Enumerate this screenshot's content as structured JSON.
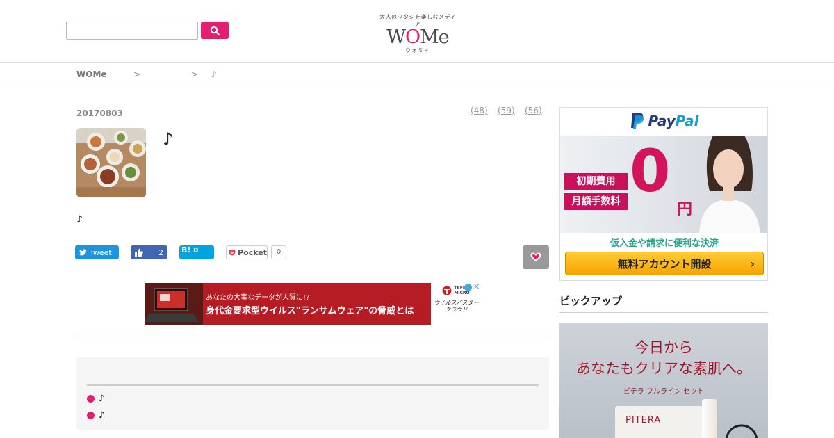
{
  "header": {
    "search_placeholder": "",
    "logo_tagline": "大人のワタシを楽しむメディア",
    "logo_wo": "W",
    "logo_o": "O",
    "logo_me": "Me",
    "logo_reading": "ウォミィ"
  },
  "breadcrumb": {
    "home": "WOMe",
    "sep1": ">",
    "sep2": ">",
    "current": "♪"
  },
  "article": {
    "date": "20170803",
    "counts": [
      "(48)",
      "(59)",
      "(56)"
    ],
    "title": "♪",
    "body": "♪"
  },
  "share": {
    "tweet": "Tweet",
    "like_count": "2",
    "hatena_label": "B!",
    "hatena_count": "0",
    "pocket_label": "Pocket",
    "pocket_count": "0"
  },
  "banner_ad": {
    "line1": "あなたの大事なデータが人質に!?",
    "line2": "身代金要求型ウイルス\"ランサムウェア\"の脅威とは",
    "brand": "TREND MICRO",
    "product": "ウイルスバスター クラウド"
  },
  "toc": {
    "items": [
      "♪",
      "♪"
    ]
  },
  "sidebar": {
    "paypal": {
      "logo_pay": "Pay",
      "logo_pal": "Pal",
      "tag1": "初期費用",
      "tag2": "月額手数料",
      "zero": "0",
      "yen": "円",
      "note": "仮入金や請求に便利な決済",
      "cta": "無料アカウント開設",
      "cta_chevron": "›"
    },
    "pickup_title": "ピックアップ",
    "pitera": {
      "headline1": "今日から",
      "headline2": "あなたもクリアな素肌へ。",
      "sub": "ピテラ フルライン セット",
      "brand": "PITERA"
    }
  },
  "colors": {
    "accent": "#e4206e",
    "tweet": "#1b95e0",
    "facebook": "#4267b2",
    "hatena": "#00a4de"
  }
}
